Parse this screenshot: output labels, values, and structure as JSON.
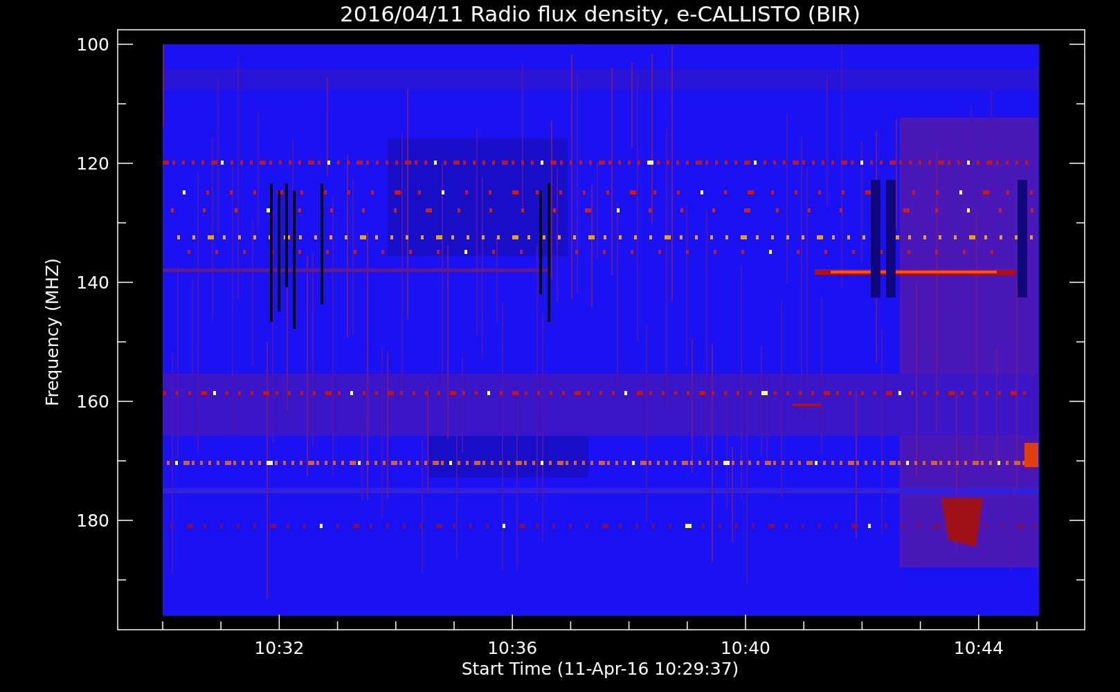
{
  "chart": {
    "title": "2016/04/11  Radio flux density, e-CALLISTO (BIR)",
    "xlabel": "Start Time (11-Apr-16 10:29:37)",
    "ylabel": "Frequency (MHZ)",
    "xticks": [
      "10:32",
      "10:36",
      "10:40",
      "10:44"
    ],
    "yticks": [
      "100",
      "120",
      "140",
      "160",
      "180"
    ]
  }
}
